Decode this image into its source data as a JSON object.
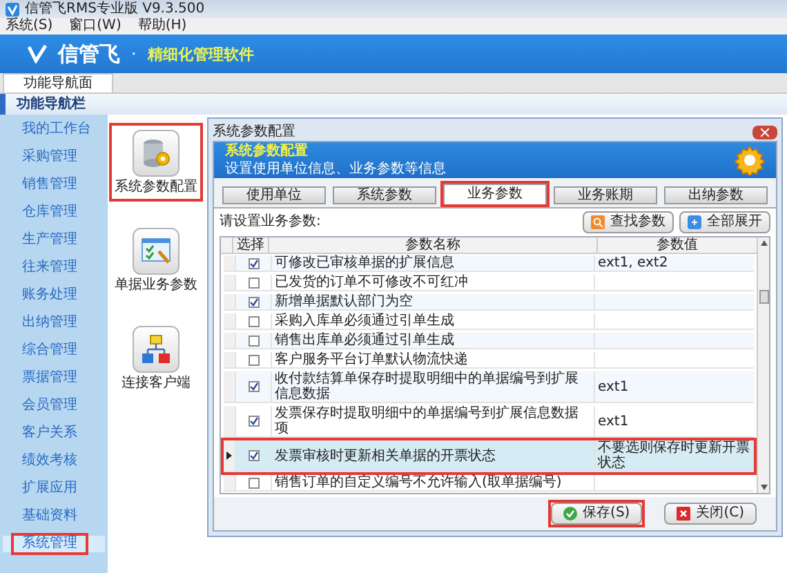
{
  "app": {
    "title": "信管飞RMS专业版 V9.3.500"
  },
  "menu": [
    {
      "label": "系统(S)"
    },
    {
      "label": "窗口(W)"
    },
    {
      "label": "帮助(H)"
    }
  ],
  "banner": {
    "logo": "信管飞",
    "separator": "·",
    "slogan": "精细化管理软件"
  },
  "tabs": [
    {
      "label": "功能导航面",
      "selected": true
    }
  ],
  "nav": {
    "title": "功能导航栏",
    "items": [
      {
        "label": "我的工作台",
        "selected": false,
        "annotated": false
      },
      {
        "label": "采购管理",
        "selected": false,
        "annotated": false
      },
      {
        "label": "销售管理",
        "selected": false,
        "annotated": false
      },
      {
        "label": "仓库管理",
        "selected": false,
        "annotated": false
      },
      {
        "label": "生产管理",
        "selected": false,
        "annotated": false
      },
      {
        "label": "往来管理",
        "selected": false,
        "annotated": false
      },
      {
        "label": "账务处理",
        "selected": false,
        "annotated": false
      },
      {
        "label": "出纳管理",
        "selected": false,
        "annotated": false
      },
      {
        "label": "综合管理",
        "selected": false,
        "annotated": false
      },
      {
        "label": "票据管理",
        "selected": false,
        "annotated": false
      },
      {
        "label": "会员管理",
        "selected": false,
        "annotated": false
      },
      {
        "label": "客户关系",
        "selected": false,
        "annotated": false
      },
      {
        "label": "绩效考核",
        "selected": false,
        "annotated": false
      },
      {
        "label": "扩展应用",
        "selected": false,
        "annotated": false
      },
      {
        "label": "基础资料",
        "selected": false,
        "annotated": false
      },
      {
        "label": "系统管理",
        "selected": true,
        "annotated": true
      }
    ]
  },
  "functions": [
    {
      "kind": "database",
      "label": "系统参数配置",
      "annotated": true
    },
    {
      "kind": "form",
      "label": "单据业务参数",
      "annotated": false
    },
    {
      "kind": "network",
      "label": "连接客户端",
      "annotated": false
    }
  ],
  "dialog": {
    "title": "系统参数配置",
    "heading": "系统参数配置",
    "subtitle": "设置使用单位信息、业务参数等信息",
    "tabs": [
      {
        "label": "使用单位",
        "selected": false,
        "annotated": false
      },
      {
        "label": "系统参数",
        "selected": false,
        "annotated": false
      },
      {
        "label": "业务参数",
        "selected": true,
        "annotated": true
      },
      {
        "label": "业务账期",
        "selected": false,
        "annotated": false
      },
      {
        "label": "出纳参数",
        "selected": false,
        "annotated": false
      }
    ],
    "prompt": "请设置业务参数:",
    "tools": [
      {
        "kind": "search",
        "label": "查找参数"
      },
      {
        "kind": "expand",
        "label": "全部展开"
      }
    ],
    "columns": [
      "选择",
      "参数名称",
      "参数值"
    ],
    "rows": [
      {
        "checked": true,
        "name": "可修改已审核单据的扩展信息",
        "value": "ext1, ext2",
        "selected": false,
        "annotated": false
      },
      {
        "checked": false,
        "name": "已发货的订单不可修改不可红冲",
        "selected": false,
        "annotated": false
      },
      {
        "checked": true,
        "name": "新增单据默认部门为空",
        "selected": false,
        "annotated": false
      },
      {
        "checked": false,
        "name": "采购入库单必须通过引单生成",
        "selected": false,
        "annotated": false
      },
      {
        "checked": false,
        "name": "销售出库单必须通过引单生成",
        "selected": false,
        "annotated": false
      },
      {
        "checked": false,
        "name": "客户服务平台订单默认物流快递",
        "selected": false,
        "annotated": false
      },
      {
        "checked": true,
        "name": "收付款结算单保存时提取明细中的单据编号到扩展信息数据",
        "value": "ext1",
        "selected": false,
        "annotated": false
      },
      {
        "checked": true,
        "name": "发票保存时提取明细中的单据编号到扩展信息数据项",
        "value": "ext1",
        "selected": false,
        "annotated": false
      },
      {
        "checked": true,
        "name": "发票审核时更新相关单据的开票状态",
        "value": "不要选则保存时更新开票状态",
        "selected": true,
        "annotated": true
      },
      {
        "checked": false,
        "name": "销售订单的自定义编号不允许输入(取单据编号)",
        "selected": false,
        "annotated": false
      }
    ],
    "buttons": [
      {
        "kind": "save",
        "label": "保存(S)",
        "annotated": true
      },
      {
        "kind": "close",
        "label": "关闭(C)",
        "annotated": false
      }
    ]
  }
}
